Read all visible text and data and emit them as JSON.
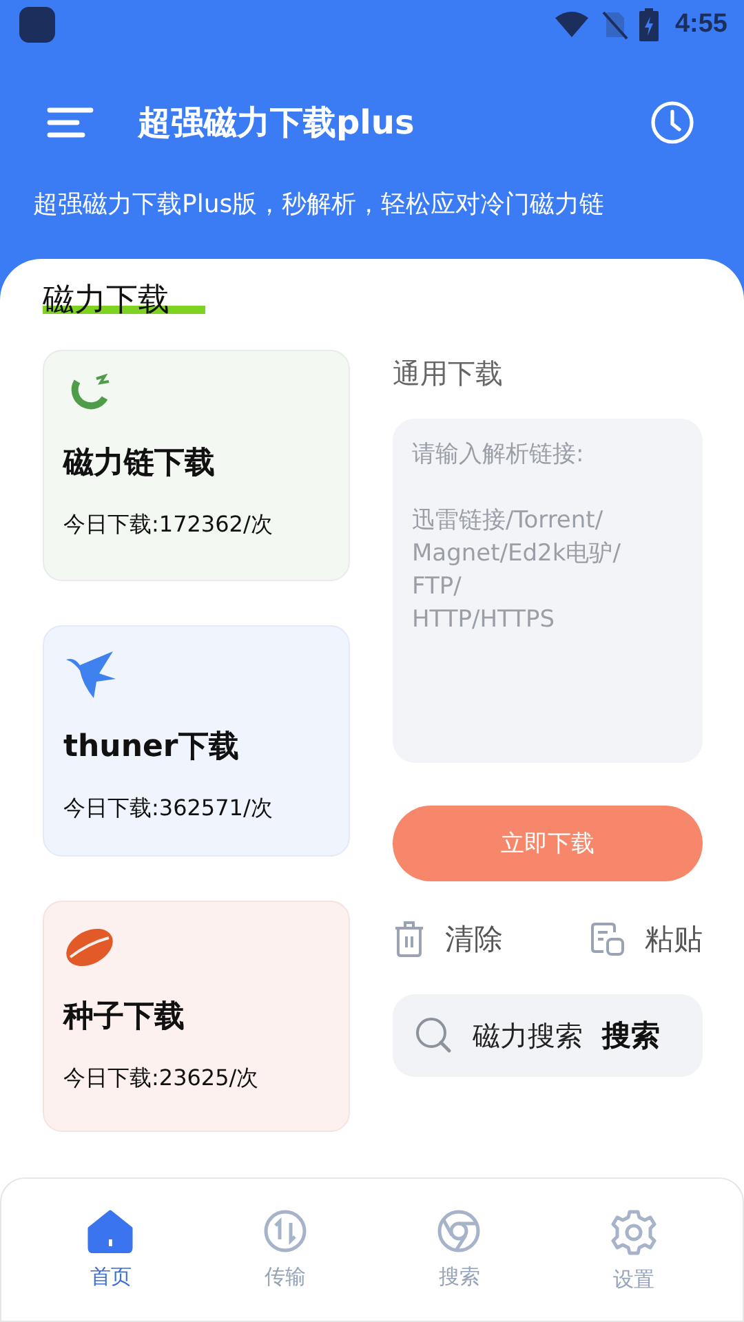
{
  "status_bar": {
    "time": "4:55"
  },
  "header": {
    "title": "超强磁力下载plus",
    "subtitle": "超强磁力下载Plus版，秒解析，轻松应对冷门磁力链"
  },
  "section_title": "磁力下载",
  "cards": [
    {
      "kind": "magnet",
      "title": "磁力链下载",
      "count": "今日下载:172362/次"
    },
    {
      "kind": "bird",
      "title": "thuner下载",
      "count": "今日下载:362571/次"
    },
    {
      "kind": "seed",
      "title": "种子下载",
      "count": "今日下载:23625/次"
    }
  ],
  "general": {
    "title": "通用下载",
    "placeholder": "请输入解析链接:\n\n迅雷链接/Torrent/\nMagnet/Ed2k电驴/\nFTP/\nHTTP/HTTPS",
    "button": "立即下载"
  },
  "actions": [
    {
      "kind": "trash",
      "label": "清除"
    },
    {
      "kind": "paste",
      "label": "粘贴"
    }
  ],
  "search": {
    "label": "磁力搜索",
    "button": "搜索"
  },
  "nav": [
    {
      "kind": "home",
      "label": "首页",
      "selected": true
    },
    {
      "kind": "transfer",
      "label": "传输",
      "selected": false
    },
    {
      "kind": "browser",
      "label": "搜索",
      "selected": false
    },
    {
      "kind": "settings",
      "label": "设置",
      "selected": false
    }
  ]
}
